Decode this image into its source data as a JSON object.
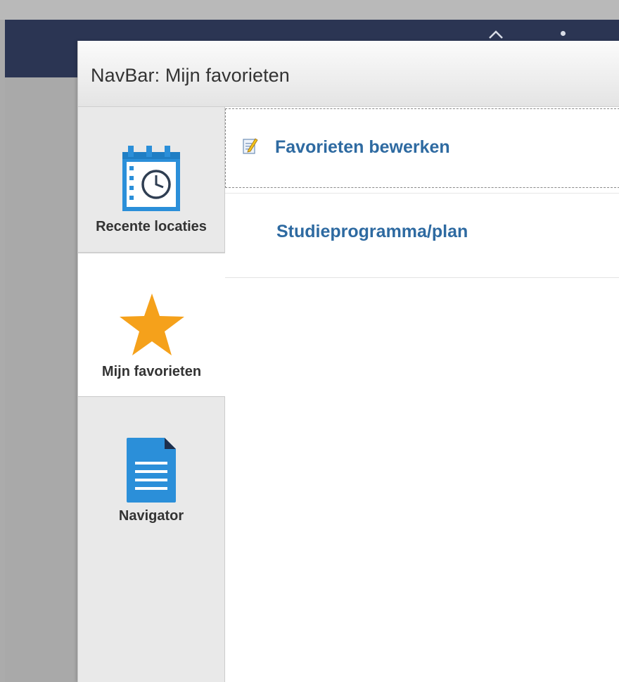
{
  "dialog": {
    "title": "NavBar: Mijn favorieten"
  },
  "side_nav": {
    "items": [
      {
        "label": "Recente locaties",
        "icon": "calendar-clock-icon"
      },
      {
        "label": "Mijn favorieten",
        "icon": "star-icon",
        "selected": true
      },
      {
        "label": "Navigator",
        "icon": "document-icon"
      }
    ]
  },
  "content": {
    "rows": [
      {
        "label": "Favorieten bewerken",
        "icon": "edit-icon"
      },
      {
        "label": "Studieprogramma/plan"
      }
    ]
  },
  "colors": {
    "header_bar": "#2b3553",
    "link": "#2e6aa1",
    "icon_blue": "#2b8fd9",
    "star": "#f5a11b"
  }
}
